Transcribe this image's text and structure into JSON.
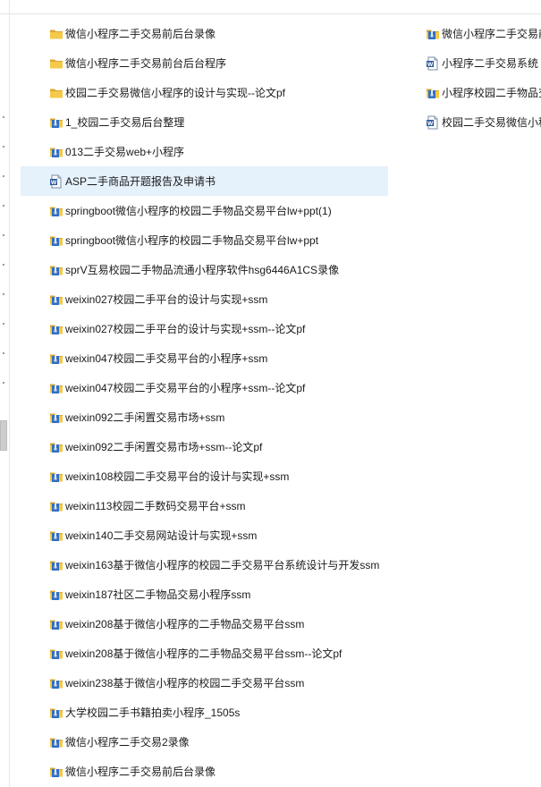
{
  "colors": {
    "selection": "#e5f1fb",
    "folder_yellow": "#f5c949",
    "folder_dark": "#dda630",
    "zip_blue": "#2e6fc6",
    "doc_blue": "#2b579a"
  },
  "icons": {
    "folder": "folder-icon",
    "archive": "archive-icon",
    "word": "word-doc-icon"
  },
  "column1": [
    {
      "name": "微信小程序二手交易前后台录像",
      "type": "folder"
    },
    {
      "name": "微信小程序二手交易前台后台程序",
      "type": "folder"
    },
    {
      "name": "校园二手交易微信小程序的设计与实现--论文pf",
      "type": "folder"
    },
    {
      "name": "1_校园二手交易后台整理",
      "type": "archive"
    },
    {
      "name": "013二手交易web+小程序",
      "type": "archive"
    },
    {
      "name": "ASP二手商品开题报告及申请书",
      "type": "word",
      "selected": true
    },
    {
      "name": "springboot微信小程序的校园二手物品交易平台lw+ppt(1)",
      "type": "archive"
    },
    {
      "name": "springboot微信小程序的校园二手物品交易平台lw+ppt",
      "type": "archive"
    },
    {
      "name": "sprV互易校园二手物品流通小程序软件hsg6446A1CS录像",
      "type": "archive"
    },
    {
      "name": "weixin027校园二手平台的设计与实现+ssm",
      "type": "archive"
    },
    {
      "name": "weixin027校园二手平台的设计与实现+ssm--论文pf",
      "type": "archive"
    },
    {
      "name": "weixin047校园二手交易平台的小程序+ssm",
      "type": "archive"
    },
    {
      "name": "weixin047校园二手交易平台的小程序+ssm--论文pf",
      "type": "archive"
    },
    {
      "name": "weixin092二手闲置交易市场+ssm",
      "type": "archive"
    },
    {
      "name": "weixin092二手闲置交易市场+ssm--论文pf",
      "type": "archive"
    },
    {
      "name": "weixin108校园二手交易平台的设计与实现+ssm",
      "type": "archive"
    },
    {
      "name": "weixin113校园二手数码交易平台+ssm",
      "type": "archive"
    },
    {
      "name": "weixin140二手交易网站设计与实现+ssm",
      "type": "archive"
    },
    {
      "name": "weixin163基于微信小程序的校园二手交易平台系统设计与开发ssm",
      "type": "archive"
    },
    {
      "name": "weixin187社区二手物品交易小程序ssm",
      "type": "archive"
    },
    {
      "name": "weixin208基于微信小程序的二手物品交易平台ssm",
      "type": "archive"
    },
    {
      "name": "weixin208基于微信小程序的二手物品交易平台ssm--论文pf",
      "type": "archive"
    },
    {
      "name": "weixin238基于微信小程序的校园二手交易平台ssm",
      "type": "archive"
    },
    {
      "name": "大学校园二手书籍拍卖小程序_1505s",
      "type": "archive"
    },
    {
      "name": "微信小程序二手交易2录像",
      "type": "archive"
    },
    {
      "name": "微信小程序二手交易前后台录像",
      "type": "archive"
    }
  ],
  "column2": [
    {
      "name": "微信小程序二手交易前",
      "type": "archive"
    },
    {
      "name": "小程序二手交易系统",
      "type": "word"
    },
    {
      "name": "小程序校园二手物品交",
      "type": "archive"
    },
    {
      "name": "校园二手交易微信小程",
      "type": "word"
    }
  ]
}
